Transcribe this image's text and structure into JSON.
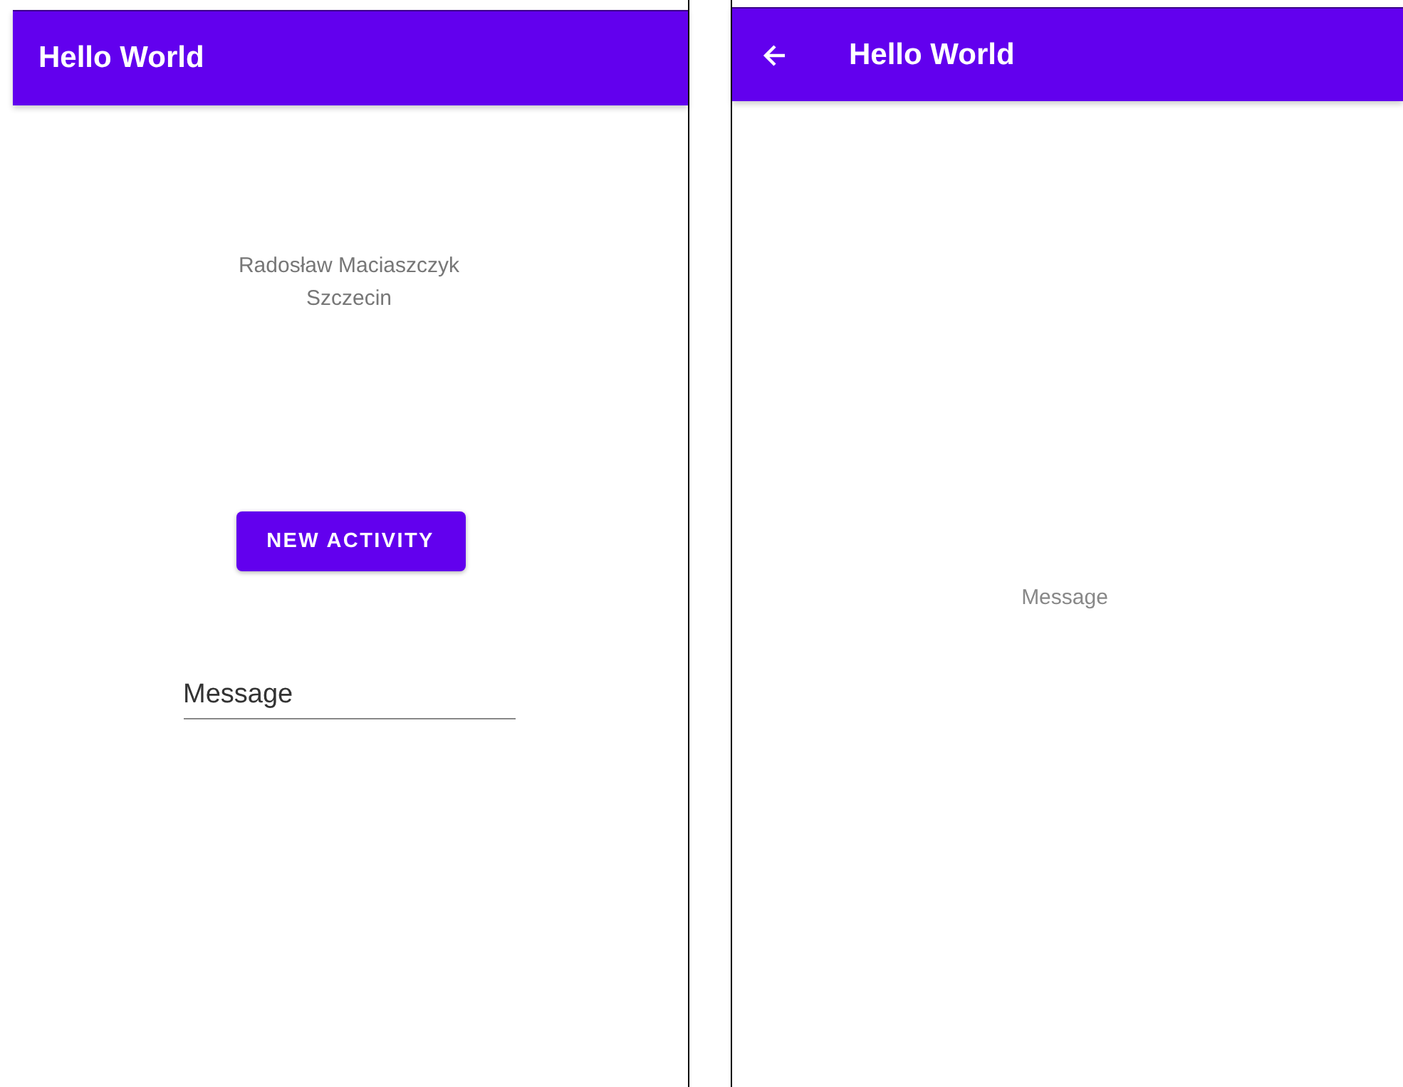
{
  "screens": [
    {
      "app_bar": {
        "title": "Hello World",
        "back_button": false
      },
      "info_lines": [
        "Radosław Maciaszczyk",
        "Szczecin"
      ],
      "button": "NEW ACTIVITY",
      "message_field": {
        "value": "Message"
      }
    },
    {
      "app_bar": {
        "title": "Hello World",
        "back_button": true
      },
      "message": "Message"
    }
  ]
}
